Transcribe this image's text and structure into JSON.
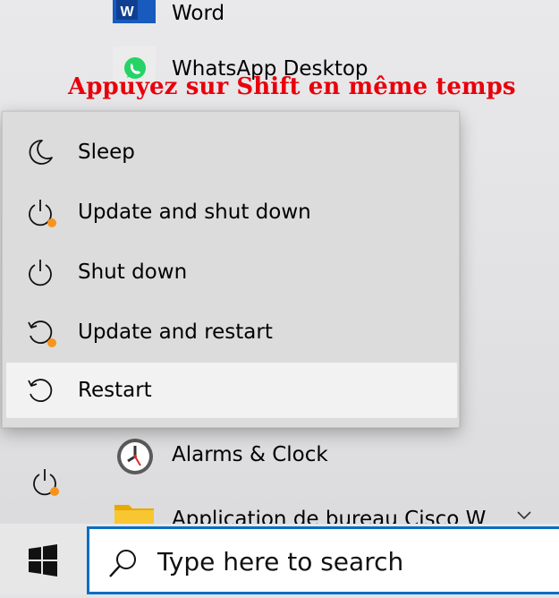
{
  "apps": [
    {
      "label": "Word",
      "icon": "word-icon"
    },
    {
      "label": "WhatsApp Desktop",
      "icon": "whatsapp-icon"
    },
    {
      "label": "Alarms & Clock",
      "icon": "alarm-clock-icon"
    },
    {
      "label": "Application de bureau Cisco W",
      "icon": "folder-icon"
    }
  ],
  "annotation": "Appuyez sur Shift en même temps",
  "power_menu": {
    "items": [
      {
        "label": "Sleep",
        "icon": "moon-icon"
      },
      {
        "label": "Update and shut down",
        "icon": "power-update-icon"
      },
      {
        "label": "Shut down",
        "icon": "power-icon"
      },
      {
        "label": "Update and restart",
        "icon": "restart-update-icon"
      },
      {
        "label": "Restart",
        "icon": "restart-icon",
        "hovered": true
      }
    ]
  },
  "taskbar": {
    "search_placeholder": "Type here to search",
    "start_icon": "windows-logo-icon",
    "search_icon": "search-icon"
  },
  "colors": {
    "accent": "#0a6ec4",
    "annotation": "#e8000b",
    "update_badge": "#f7941d",
    "word_blue": "#185abd",
    "whatsapp_green": "#25d366",
    "folder_yellow": "#f8c630"
  }
}
